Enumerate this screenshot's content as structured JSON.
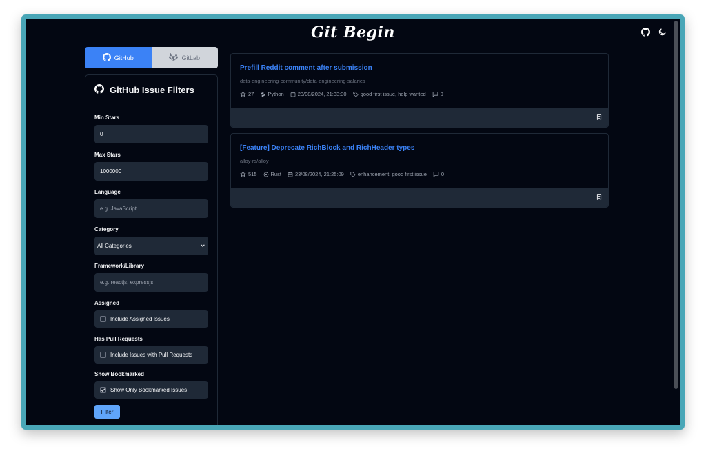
{
  "header": {
    "title": "Git Begin",
    "icons": [
      "github-icon",
      "moon-icon"
    ]
  },
  "tabs": [
    {
      "label": "GitHub",
      "active": true,
      "icon": "github-icon"
    },
    {
      "label": "GitLab",
      "active": false,
      "icon": "gitlab-icon"
    }
  ],
  "filters": {
    "title": "GitHub Issue Filters",
    "min_stars_label": "Min Stars",
    "min_stars_value": "0",
    "max_stars_label": "Max Stars",
    "max_stars_value": "1000000",
    "language_label": "Language",
    "language_placeholder": "e.g. JavaScript",
    "category_label": "Category",
    "category_value": "All Categories",
    "framework_label": "Framework/Library",
    "framework_placeholder": "e.g. reactjs, expressjs",
    "assigned_label": "Assigned",
    "assigned_checkbox": "Include Assigned Issues",
    "assigned_checked": false,
    "pr_label": "Has Pull Requests",
    "pr_checkbox": "Include Issues with Pull Requests",
    "pr_checked": false,
    "bookmarked_label": "Show Bookmarked",
    "bookmarked_checkbox": "Show Only Bookmarked Issues",
    "bookmarked_checked": true,
    "filter_button": "Filter"
  },
  "issues": [
    {
      "title": "Prefill Reddit comment after submission",
      "repo": "data-engineering-community/data-engineering-salaries",
      "stars": "27",
      "language": "Python",
      "date": "23/08/2024, 21:33:30",
      "labels": "good first issue, help wanted",
      "comments": "0"
    },
    {
      "title": "[Feature] Deprecate RichBlock and RichHeader types",
      "repo": "alloy-rs/alloy",
      "stars": "515",
      "language": "Rust",
      "date": "23/08/2024, 21:25:09",
      "labels": "enhancement, good first issue",
      "comments": "0"
    }
  ],
  "colors": {
    "background": "#030712",
    "accent": "#3b82f6",
    "frame": "#49a6b7",
    "panel": "#1f2937"
  }
}
